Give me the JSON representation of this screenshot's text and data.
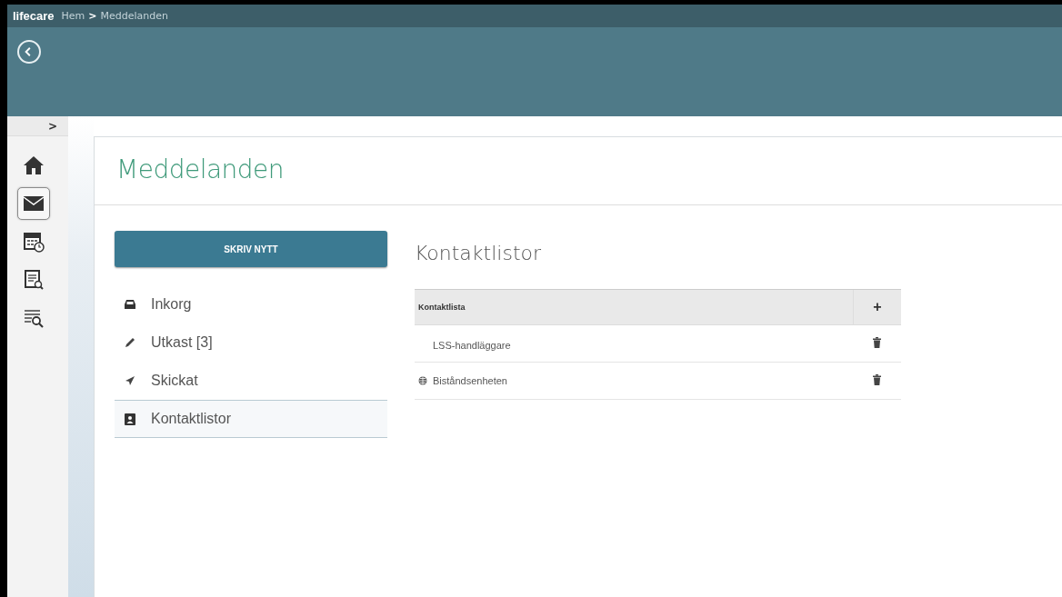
{
  "header": {
    "brand": "lifecare",
    "breadcrumb": [
      {
        "label": "Hem"
      },
      {
        "label": "Meddelanden"
      }
    ],
    "separator": ">"
  },
  "rail": {
    "toggle": ">",
    "items": [
      {
        "kind": "home",
        "selected": false
      },
      {
        "kind": "mail",
        "selected": true
      },
      {
        "kind": "calendar",
        "selected": false
      },
      {
        "kind": "report",
        "selected": false
      },
      {
        "kind": "search",
        "selected": false
      }
    ]
  },
  "page": {
    "title": "Meddelanden",
    "compose_button": "SKRIV NYTT",
    "nav": [
      {
        "kind": "inbox",
        "label": "Inkorg",
        "selected": false
      },
      {
        "kind": "draft",
        "label": "Utkast [3]",
        "selected": false
      },
      {
        "kind": "sent",
        "label": "Skickat",
        "selected": false
      },
      {
        "kind": "contacts",
        "label": "Kontaktlistor",
        "selected": true
      }
    ]
  },
  "contacts": {
    "title": "Kontaktlistor",
    "column": "Kontaktlista",
    "add": "+",
    "rows": [
      {
        "name": "LSS-handläggare",
        "shared": false
      },
      {
        "name": "Biståndsenheten",
        "shared": true
      }
    ]
  }
}
